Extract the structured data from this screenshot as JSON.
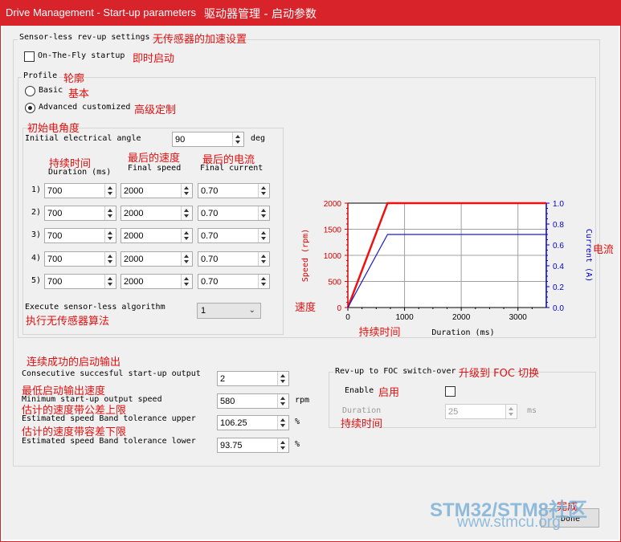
{
  "window": {
    "title_en": "Drive Management - Start-up parameters",
    "title_cn": "驱动器管理 - 启动参数"
  },
  "sensorless": {
    "label": "Sensor-less rev-up settings",
    "label_cn": "无传感器的加速设置",
    "onthefly_label": "On-The-Fly startup",
    "onthefly_cn": "即时启动",
    "onthefly_checked": false
  },
  "profile": {
    "label": "Profile",
    "label_cn": "轮廓",
    "basic_label": "Basic",
    "basic_cn": "基本",
    "advanced_label": "Advanced customized",
    "advanced_cn": "高级定制",
    "selected": "advanced"
  },
  "angle": {
    "cn": "初始电角度",
    "label": "Initial electrical angle",
    "value": "90",
    "unit": "deg"
  },
  "table": {
    "headers": [
      {
        "cn": "持续时间",
        "en": "Duration (ms)"
      },
      {
        "cn": "最后的速度",
        "en": "Final speed"
      },
      {
        "cn": "最后的电流",
        "en": "Final current"
      }
    ],
    "rows": [
      {
        "index": "1)",
        "duration": "700",
        "speed": "2000",
        "current": "0.70"
      },
      {
        "index": "2)",
        "duration": "700",
        "speed": "2000",
        "current": "0.70"
      },
      {
        "index": "3)",
        "duration": "700",
        "speed": "2000",
        "current": "0.70"
      },
      {
        "index": "4)",
        "duration": "700",
        "speed": "2000",
        "current": "0.70"
      },
      {
        "index": "5)",
        "duration": "700",
        "speed": "2000",
        "current": "0.70"
      }
    ]
  },
  "execute": {
    "label": "Execute sensor-less algorithm",
    "cn": "执行无传感器算法",
    "value": "1"
  },
  "chart_data": {
    "type": "line",
    "xlabel": "Duration (ms)",
    "xlabel_cn": "持续时间",
    "ylabel_left": "Speed (rpm)",
    "ylabel_left_cn": "速度",
    "ylabel_right": "Current (A)",
    "ylabel_right_cn": "电流",
    "xlim": [
      0,
      3500
    ],
    "ylim_left": [
      0,
      2000
    ],
    "ylim_right": [
      0,
      1.0
    ],
    "x_ticks": [
      0,
      1000,
      2000,
      3000
    ],
    "y_left_ticks": [
      0,
      500,
      1000,
      1500,
      2000
    ],
    "y_right_ticks": [
      0.0,
      0.2,
      0.4,
      0.6,
      0.8,
      1.0
    ],
    "y_left_tick_labels": [
      "0",
      "500",
      "1000",
      "1500",
      "2000"
    ],
    "y_right_tick_labels": [
      "0.0",
      "0.2",
      "0.4",
      "0.6",
      "0.8",
      "1.0"
    ],
    "grid": true,
    "colors": {
      "speed": "#ee1111",
      "current": "#1a1acc",
      "left_axis": "#dd0000",
      "right_axis": "#0000cc"
    },
    "series": [
      {
        "axis": "left",
        "x": [
          0,
          700,
          3500
        ],
        "y": [
          0,
          2000,
          2000
        ]
      },
      {
        "axis": "right",
        "x": [
          0,
          700,
          3500
        ],
        "y": [
          0,
          0.7,
          0.7
        ]
      }
    ]
  },
  "startup": {
    "consecutive_cn": "连续成功的启动输出",
    "consecutive_label": "Consecutive succesful start-up output",
    "consecutive_value": "2",
    "min_cn": "最低启动输出速度",
    "min_label": "Minimum start-up output speed",
    "min_value": "580",
    "min_unit": "rpm",
    "upper_cn": "估计的速度带公差上限",
    "upper_label": "Estimated speed Band tolerance upper",
    "upper_value": "106.25",
    "upper_unit": "%",
    "lower_cn": "估计的速度带容差下限",
    "lower_label": "Estimated speed Band tolerance lower",
    "lower_value": "93.75",
    "lower_unit": "%"
  },
  "switchover": {
    "label": "Rev-up to FOC switch-over",
    "label_cn": "升级到 FOC 切换",
    "enable_label": "Enable",
    "enable_cn": "启用",
    "enable_checked": false,
    "duration_label": "Duration",
    "duration_cn": "持续时间",
    "duration_value": "25",
    "duration_unit": "ms"
  },
  "done": {
    "label": "Done",
    "cn": "完成"
  },
  "watermark": {
    "line1": "STM32/STM8社区",
    "line2": "www.stmcu.org"
  }
}
